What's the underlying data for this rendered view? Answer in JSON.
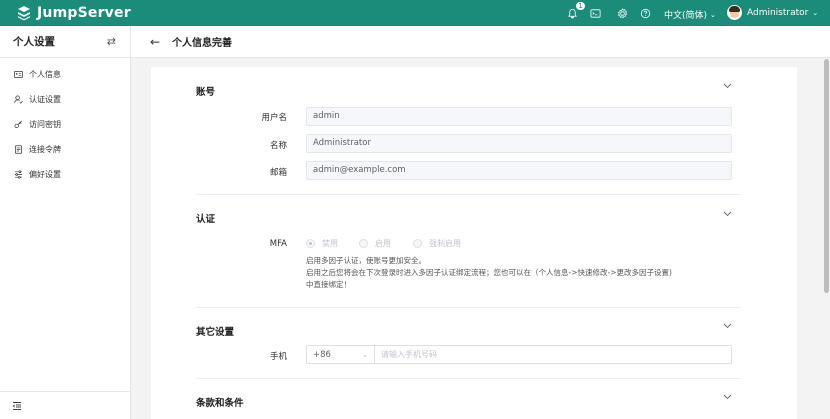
{
  "app": {
    "brand_name": "JumpServer",
    "brand_color": "#1b8c7a"
  },
  "topbar": {
    "notification_count": "1",
    "icons": [
      "bell-icon",
      "terminal-icon",
      "gear-icon",
      "help-icon"
    ],
    "language": "中文(简体)",
    "username": "Administrator"
  },
  "sidebar": {
    "title": "个人设置",
    "items": [
      {
        "label": "个人信息",
        "icon": "id-card-icon"
      },
      {
        "label": "认证设置",
        "icon": "user-auth-icon"
      },
      {
        "label": "访问密钥",
        "icon": "key-icon"
      },
      {
        "label": "连接令牌",
        "icon": "token-icon"
      },
      {
        "label": "偏好设置",
        "icon": "sliders-icon"
      }
    ]
  },
  "page": {
    "title": "个人信息完善"
  },
  "sections": {
    "account": {
      "title": "账号",
      "username_label": "用户名",
      "username_value": "admin",
      "name_label": "名称",
      "name_value": "Administrator",
      "email_label": "邮箱",
      "email_value": "admin@example.com"
    },
    "auth": {
      "title": "认证",
      "mfa_label": "MFA",
      "options": [
        "禁用",
        "启用",
        "强制启用"
      ],
      "selected": "禁用",
      "hint_lines": [
        "启用多因子认证，使账号更加安全。",
        "启用之后您将会在下次登录时进入多因子认证绑定流程；您也可以在（个人信息->快速修改->更改多因子设置)",
        "中直接绑定！"
      ]
    },
    "other": {
      "title": "其它设置",
      "phone_label": "手机",
      "phone_code": "+86",
      "phone_placeholder": "请输入手机号码"
    },
    "terms": {
      "title": "条款和条件"
    }
  }
}
